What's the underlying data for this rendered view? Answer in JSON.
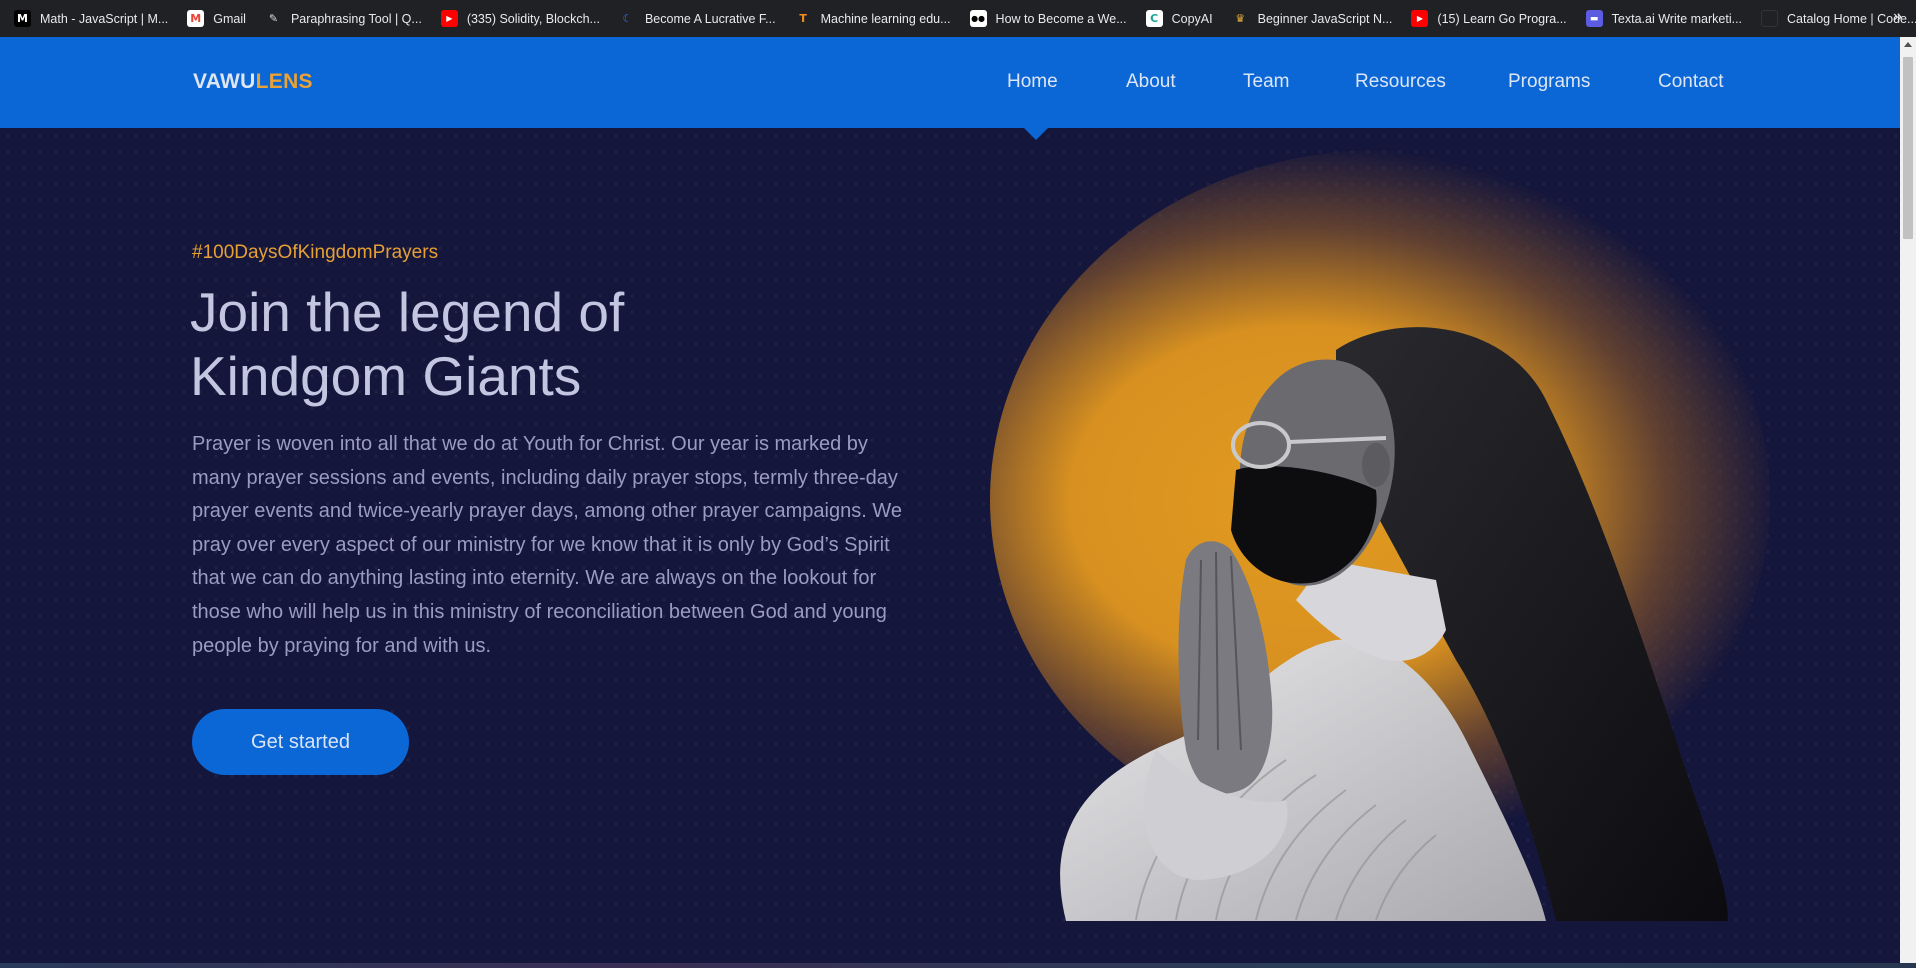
{
  "bookmarks": [
    {
      "label": "Math - JavaScript | M...",
      "icon": "medium-icon",
      "color": "#000000",
      "glyph": "M"
    },
    {
      "label": "Gmail",
      "icon": "gmail-icon",
      "color": "#ea4335",
      "glyph": "M"
    },
    {
      "label": "Paraphrasing Tool | Q...",
      "icon": "quill-icon",
      "color": "#202124",
      "glyph": "✎"
    },
    {
      "label": "(335) Solidity, Blockch...",
      "icon": "youtube-icon",
      "color": "#ff0000",
      "glyph": "▶"
    },
    {
      "label": "Become A Lucrative F...",
      "icon": "moon-icon",
      "color": "#202124",
      "glyph": "☾"
    },
    {
      "label": "Machine learning edu...",
      "icon": "tensorflow-icon",
      "color": "#f28e1c",
      "glyph": "T"
    },
    {
      "label": "How to Become a We...",
      "icon": "medium-dots-icon",
      "color": "#000000",
      "glyph": "●●"
    },
    {
      "label": "CopyAI",
      "icon": "copyai-icon",
      "color": "#ffffff",
      "glyph": "C"
    },
    {
      "label": "Beginner JavaScript N...",
      "icon": "crown-icon",
      "color": "#202124",
      "glyph": "♛"
    },
    {
      "label": "(15) Learn Go Progra...",
      "icon": "youtube-icon",
      "color": "#ff0000",
      "glyph": "▶"
    },
    {
      "label": "Texta.ai Write marketi...",
      "icon": "texta-icon",
      "color": "#5b5ce2",
      "glyph": "▬"
    },
    {
      "label": "Catalog Home | Code...",
      "icon": "codecademy-icon",
      "color": "#202124",
      "glyph": ""
    }
  ],
  "bookmarks_more": "»",
  "nav": {
    "logo_part1": "VAWU",
    "logo_part2": "LENS",
    "items": [
      "Home",
      "About",
      "Team",
      "Resources",
      "Programs",
      "Contact"
    ],
    "active": "Home"
  },
  "hero": {
    "hashtag": "#100DaysOfKingdomPrayers",
    "headline_line1": "Join the legend of",
    "headline_line2": "Kindgom Giants",
    "body": "Prayer is woven into all that we do at Youth for Christ. Our year is marked by many prayer sessions and events, including daily prayer stops, termly three-day prayer events and twice-yearly prayer days, among other prayer campaigns. We pray over every aspect of our ministry for we know that it is only by God’s Spirit that we can do anything lasting into eternity. We are always on the lookout for those who will help us in this ministry of reconciliation between God and young people by praying for and with us.",
    "cta_label": "Get started"
  },
  "colors": {
    "brand_blue": "#0b66d6",
    "accent_gold": "#e6a033",
    "background": "#15163b"
  }
}
